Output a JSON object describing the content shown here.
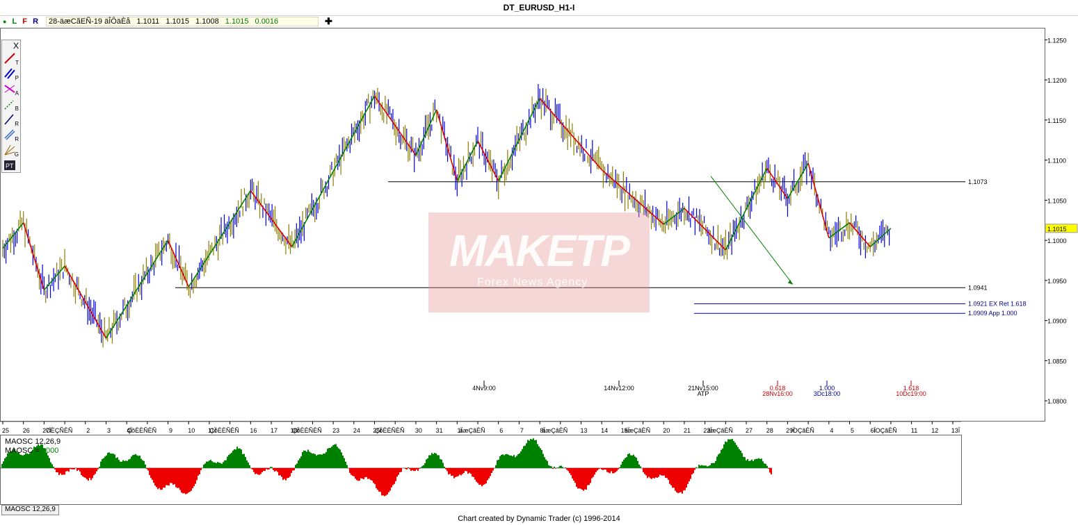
{
  "window": {
    "title": "DT_EURUSD_H1-I"
  },
  "infobar": {
    "flags": [
      "L",
      "F",
      "R"
    ],
    "quote_label": "28-äæCãEÑ-19 äÎÔäÈå",
    "open": "1.1011",
    "high": "1.1015",
    "low": "1.1008",
    "close": "1.1015",
    "change": "0.0016"
  },
  "toolbox": {
    "items": [
      {
        "icon": "trend-line-icon",
        "label": "T"
      },
      {
        "icon": "parallel-lines-icon",
        "label": "P"
      },
      {
        "icon": "alternate-price-projection-icon",
        "label": "A"
      },
      {
        "icon": "bar-count-icon",
        "label": "B"
      },
      {
        "icon": "retracement-icon",
        "label": "R"
      },
      {
        "icon": "range-retracement-icon",
        "label": "R"
      },
      {
        "icon": "gann-fan-icon",
        "label": "G"
      },
      {
        "icon": "pattern-template-icon",
        "label": "PT"
      }
    ],
    "close_label": "X"
  },
  "colors": {
    "up": "#0000dd",
    "down": "#8b7d00",
    "swing_up": "#008000",
    "swing_down": "#dd0000",
    "osc_pos": "#008000",
    "osc_neg": "#ee0000"
  },
  "chart_data": {
    "type": "line",
    "title": "DT_EURUSD_H1-I",
    "symbol": "EURUSD",
    "timeframe": "H1",
    "ylim": [
      1.0775,
      1.1265
    ],
    "y_ticks": [
      "1.1250",
      "1.1200",
      "1.1150",
      "1.1100",
      "1.1050",
      "1.1000",
      "1.0950",
      "1.0900",
      "1.0850",
      "1.0800"
    ],
    "x_tick_labels": [
      "25",
      "26",
      "27Ï",
      "OÈÇÑÈÑ",
      "2",
      "3",
      "4Ï",
      "ÇõÈÈÑÈÑ",
      "9",
      "10",
      "11Ï",
      "ÇõÈÈÑÈÑ",
      "16",
      "17",
      "18Ï",
      "ÇõÈÈÑÈÑ",
      "23",
      "24",
      "25Ï",
      "ÇõÈÈÑÈÑ",
      "30",
      "31",
      "1Ï",
      "äæÇãÈÑ",
      "6",
      "7",
      "8Ï",
      "äæÇãÈÑ",
      "13",
      "14",
      "15Ï",
      "äæÇãÈÑ",
      "20",
      "21",
      "22Ï",
      "äæÇãÈÑ",
      "27",
      "28",
      "29Ï",
      "IOÇãÈÑ",
      "4",
      "5",
      "6Ï",
      "IOÇãÈÑ",
      "11",
      "12",
      "13Ï"
    ],
    "swing_points": [
      {
        "t": 0,
        "p": 1.099
      },
      {
        "t": 1,
        "p": 1.1022
      },
      {
        "t": 2,
        "p": 1.0938
      },
      {
        "t": 3,
        "p": 1.0968
      },
      {
        "t": 5,
        "p": 1.0878
      },
      {
        "t": 8,
        "p": 1.1
      },
      {
        "t": 9,
        "p": 1.0942
      },
      {
        "t": 12,
        "p": 1.1062
      },
      {
        "t": 14,
        "p": 1.0992
      },
      {
        "t": 18,
        "p": 1.118
      },
      {
        "t": 20,
        "p": 1.1106
      },
      {
        "t": 21,
        "p": 1.1163
      },
      {
        "t": 22,
        "p": 1.1074
      },
      {
        "t": 23,
        "p": 1.1124
      },
      {
        "t": 24,
        "p": 1.1074
      },
      {
        "t": 26,
        "p": 1.1177
      },
      {
        "t": 29,
        "p": 1.1088
      },
      {
        "t": 32,
        "p": 1.102
      },
      {
        "t": 33,
        "p": 1.104
      },
      {
        "t": 35,
        "p": 1.0988
      },
      {
        "t": 37,
        "p": 1.109
      },
      {
        "t": 38,
        "p": 1.1052
      },
      {
        "t": 39,
        "p": 1.1096
      },
      {
        "t": 40,
        "p": 1.1003
      },
      {
        "t": 41,
        "p": 1.1022
      },
      {
        "t": 42,
        "p": 1.0992
      },
      {
        "t": 43,
        "p": 1.1015
      }
    ],
    "horizontal_levels": [
      {
        "value": 1.1073,
        "label": "1.1073",
        "color": "#000000"
      },
      {
        "value": 1.0941,
        "label": "1.0941",
        "color": "#000000"
      },
      {
        "value": 1.0921,
        "label": "1.0921 EX Ret 1.618",
        "color": "#00008b"
      },
      {
        "value": 1.0909,
        "label": "1.0909 App 1.000",
        "color": "#00008b"
      }
    ],
    "current_price": "1.1015",
    "time_markers": [
      {
        "label": "4Nv9:00",
        "sub": "",
        "color": "#000000"
      },
      {
        "label": "14Nv12:00",
        "sub": "",
        "color": "#000000"
      },
      {
        "label": "21Nv15:00",
        "sub": "ATP",
        "color": "#000000"
      },
      {
        "label": "0.618",
        "sub": "28Nv16:00",
        "color": "#cc0000"
      },
      {
        "label": "1.000",
        "sub": "3Dc18:00",
        "color": "#00008b"
      },
      {
        "label": "1.618",
        "sub": "10Dc19:00",
        "color": "#cc0000"
      }
    ],
    "oscillator": {
      "name": "MAOSC 12,26,9",
      "label_line1": "MAOSC 12,26,9",
      "label_line2": "MAOSC =",
      "current_value": "0.000",
      "tab_label": "MAOSC 12,26,9"
    }
  },
  "watermark": {
    "brand": "MAKETP",
    "tagline": "Forex News Agency"
  },
  "footer": {
    "text": "Chart created by Dynamic Trader  (c)  1996-2014"
  }
}
